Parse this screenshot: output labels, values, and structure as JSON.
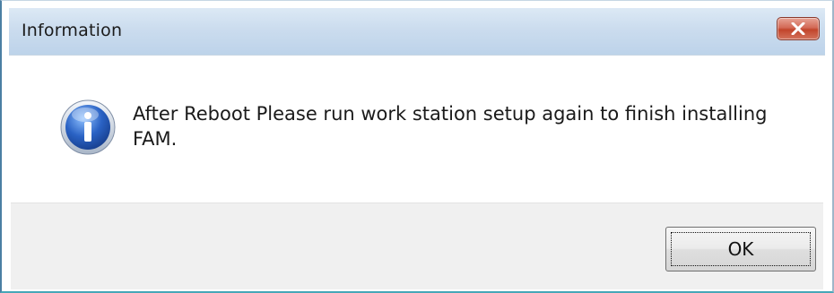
{
  "window": {
    "title": "Information",
    "close_icon": "close-icon"
  },
  "content": {
    "icon": "info-icon",
    "message": "After Reboot Please run work station setup again to finish installing FAM."
  },
  "footer": {
    "ok_label": "OK"
  },
  "colors": {
    "titlebar": "#cbdcee",
    "close_button": "#c2452b",
    "footer": "#f0f0f0",
    "info_icon": "#2a62c4"
  }
}
